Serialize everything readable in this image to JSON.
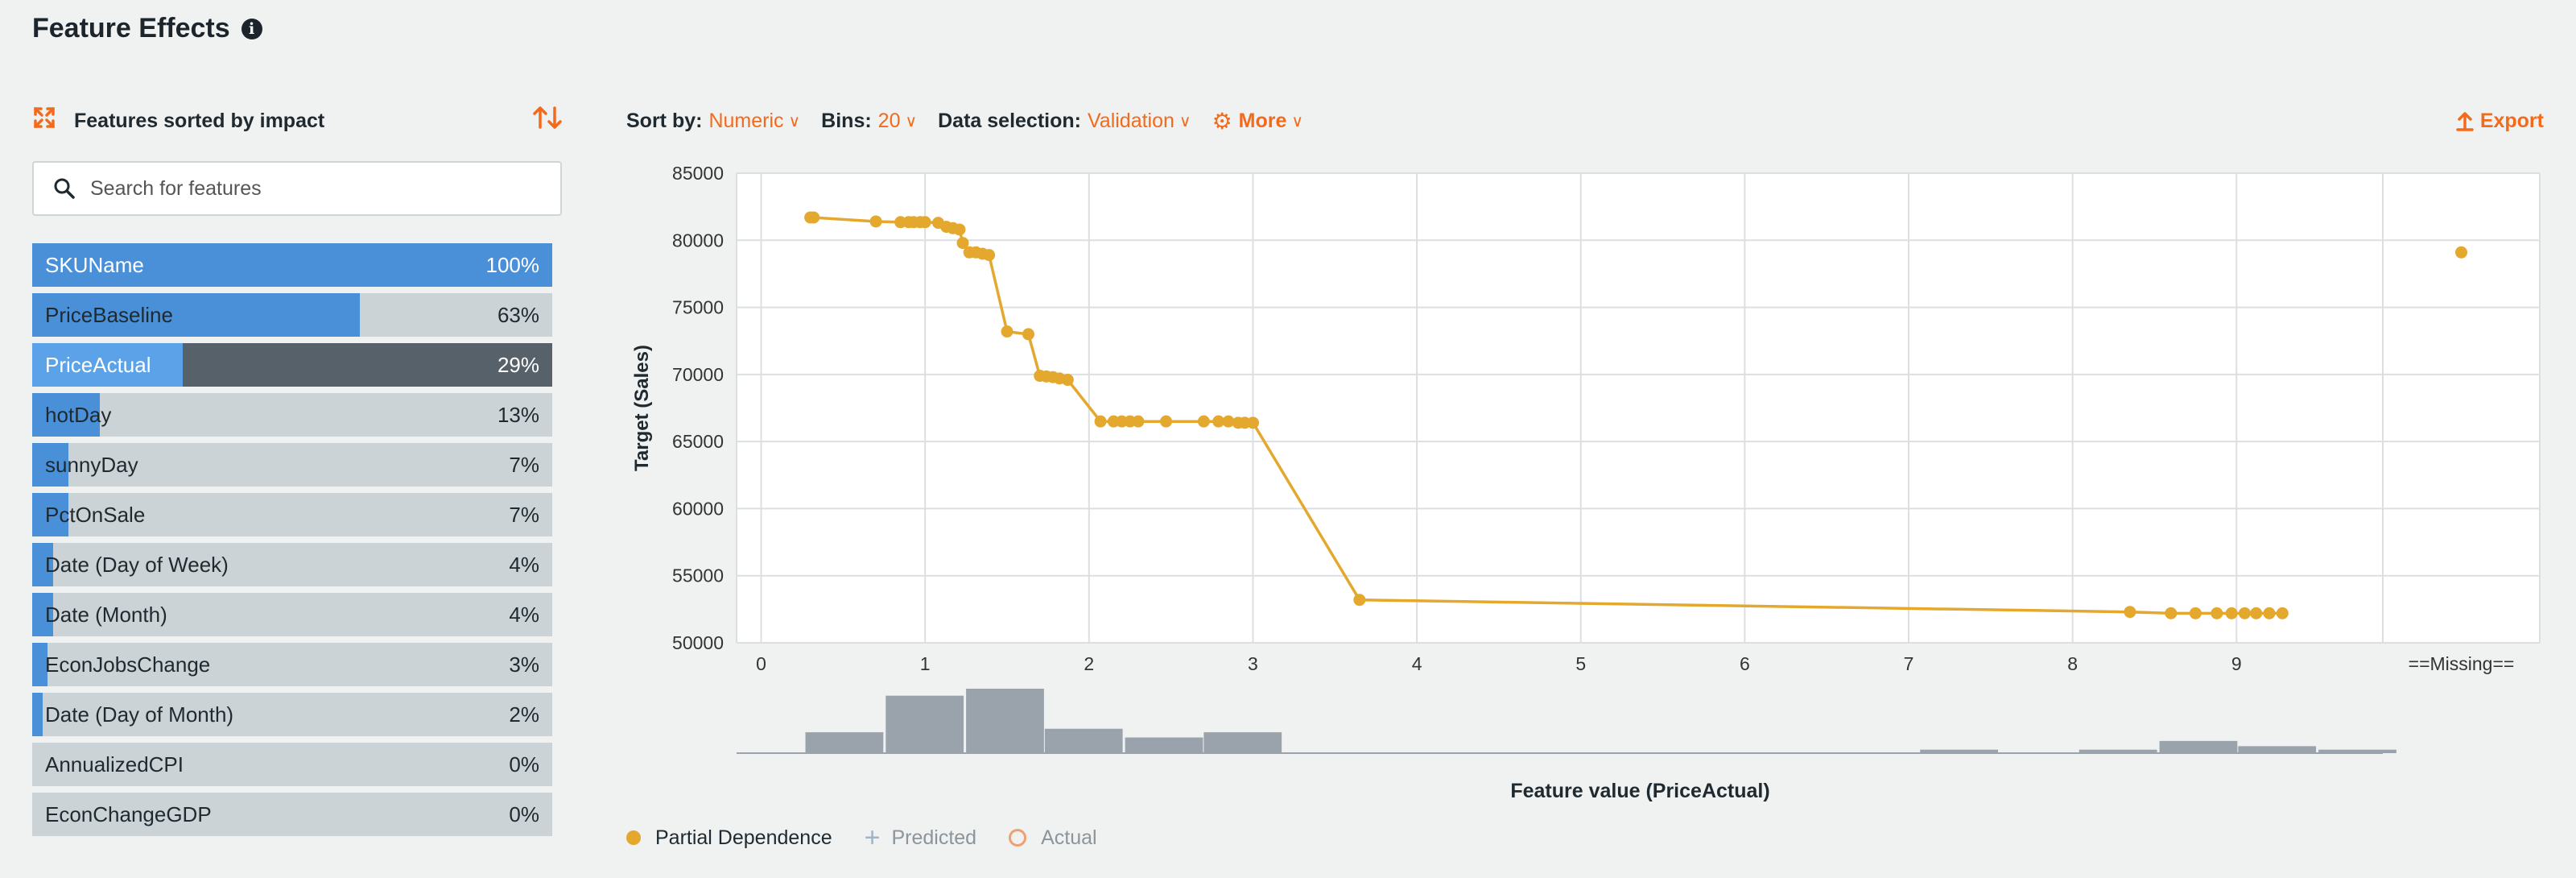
{
  "page": {
    "title": "Feature Effects",
    "info_icon": "i"
  },
  "left_panel": {
    "header_label": "Features sorted by impact",
    "search_placeholder": "Search for features",
    "features": [
      {
        "name": "SKUName",
        "pct_label": "100%",
        "impact": 1.0
      },
      {
        "name": "PriceBaseline",
        "pct_label": "63%",
        "impact": 0.63
      },
      {
        "name": "PriceActual",
        "pct_label": "29%",
        "impact": 0.29,
        "selected": true
      },
      {
        "name": "hotDay",
        "pct_label": "13%",
        "impact": 0.13
      },
      {
        "name": "sunnyDay",
        "pct_label": "7%",
        "impact": 0.07
      },
      {
        "name": "PctOnSale",
        "pct_label": "7%",
        "impact": 0.07
      },
      {
        "name": "Date (Day of Week)",
        "pct_label": "4%",
        "impact": 0.04
      },
      {
        "name": "Date (Month)",
        "pct_label": "4%",
        "impact": 0.04
      },
      {
        "name": "EconJobsChange",
        "pct_label": "3%",
        "impact": 0.03
      },
      {
        "name": "Date (Day of Month)",
        "pct_label": "2%",
        "impact": 0.02
      },
      {
        "name": "AnnualizedCPI",
        "pct_label": "0%",
        "impact": 0.0
      },
      {
        "name": "EconChangeGDP",
        "pct_label": "0%",
        "impact": 0.0
      }
    ]
  },
  "toolbar": {
    "sort_label": "Sort by:",
    "sort_value": "Numeric",
    "bins_label": "Bins:",
    "bins_value": "20",
    "data_label": "Data selection:",
    "data_value": "Validation",
    "more_label": "More",
    "export_label": "Export"
  },
  "colors": {
    "accent": "#f26b1d",
    "partial_dependence": "#e3a82d",
    "impact_bar": "#4a90d9",
    "histogram": "#9aa3ab"
  },
  "legend": {
    "partial_dependence": "Partial Dependence",
    "predicted": "Predicted",
    "actual": "Actual"
  },
  "chart_data": {
    "type": "line",
    "xlabel": "Feature value (PriceActual)",
    "ylabel": "Target (Sales)",
    "xlim": [
      -0.15,
      10.85
    ],
    "ylim": [
      50000,
      85000
    ],
    "x_ticks": [
      0,
      1,
      2,
      3,
      4,
      5,
      6,
      7,
      8,
      9
    ],
    "y_ticks": [
      50000,
      55000,
      60000,
      65000,
      70000,
      75000,
      80000,
      85000
    ],
    "missing_label": "==Missing==",
    "grid": true,
    "series": [
      {
        "name": "Partial Dependence",
        "points": [
          [
            0.3,
            81700
          ],
          [
            0.32,
            81700
          ],
          [
            0.7,
            81400
          ],
          [
            0.85,
            81350
          ],
          [
            0.9,
            81350
          ],
          [
            0.93,
            81350
          ],
          [
            0.97,
            81350
          ],
          [
            1.0,
            81350
          ],
          [
            1.08,
            81300
          ],
          [
            1.13,
            81000
          ],
          [
            1.17,
            80900
          ],
          [
            1.21,
            80800
          ],
          [
            1.23,
            79800
          ],
          [
            1.27,
            79100
          ],
          [
            1.31,
            79100
          ],
          [
            1.35,
            79000
          ],
          [
            1.39,
            78900
          ],
          [
            1.5,
            73200
          ],
          [
            1.63,
            73000
          ],
          [
            1.7,
            69900
          ],
          [
            1.74,
            69850
          ],
          [
            1.78,
            69800
          ],
          [
            1.82,
            69700
          ],
          [
            1.87,
            69600
          ],
          [
            2.07,
            66500
          ],
          [
            2.15,
            66500
          ],
          [
            2.2,
            66500
          ],
          [
            2.25,
            66500
          ],
          [
            2.3,
            66500
          ],
          [
            2.47,
            66500
          ],
          [
            2.7,
            66500
          ],
          [
            2.79,
            66500
          ],
          [
            2.85,
            66500
          ],
          [
            2.91,
            66400
          ],
          [
            2.95,
            66400
          ],
          [
            3.0,
            66400
          ],
          [
            3.65,
            53200
          ],
          [
            8.35,
            52300
          ],
          [
            8.6,
            52200
          ],
          [
            8.75,
            52200
          ],
          [
            8.88,
            52200
          ],
          [
            8.97,
            52200
          ],
          [
            9.05,
            52200
          ],
          [
            9.12,
            52200
          ],
          [
            9.2,
            52200
          ],
          [
            9.28,
            52200
          ]
        ],
        "missing_value": 79100
      }
    ],
    "histogram": {
      "bin_width": 0.485,
      "bins": [
        {
          "start": 0.27,
          "count": 12
        },
        {
          "start": 0.76,
          "count": 33
        },
        {
          "start": 1.25,
          "count": 37
        },
        {
          "start": 1.73,
          "count": 14
        },
        {
          "start": 2.22,
          "count": 9
        },
        {
          "start": 2.7,
          "count": 12
        },
        {
          "start": 7.07,
          "count": 2
        },
        {
          "start": 8.04,
          "count": 2
        },
        {
          "start": 8.53,
          "count": 7
        },
        {
          "start": 9.01,
          "count": 4
        },
        {
          "start": 9.5,
          "count": 2
        }
      ]
    }
  }
}
